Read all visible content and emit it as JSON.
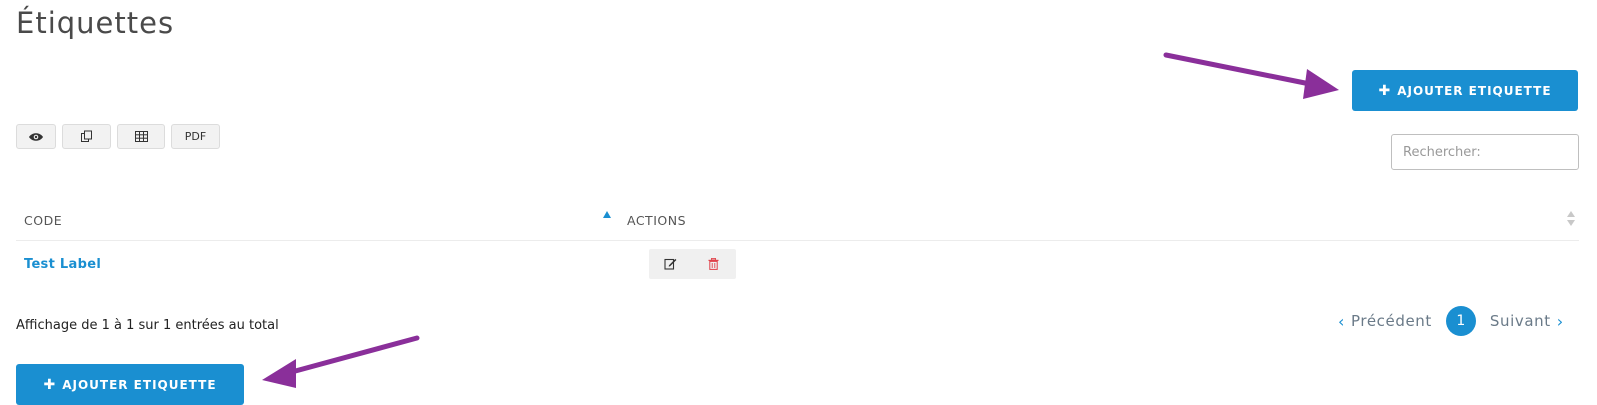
{
  "page": {
    "title": "Étiquettes"
  },
  "toolbar": {
    "add_label": "AJOUTER ETIQUETTE",
    "add_icon": "plus-icon",
    "export_buttons": [
      {
        "name": "view-columns-button",
        "icon": "eye-icon"
      },
      {
        "name": "copy-button",
        "icon": "copy-icon"
      },
      {
        "name": "excel-button",
        "icon": "table-icon"
      },
      {
        "name": "pdf-button",
        "label": "PDF"
      }
    ]
  },
  "search": {
    "placeholder": "Rechercher:",
    "value": ""
  },
  "table": {
    "columns": [
      "CODE",
      "ACTIONS"
    ],
    "rows": [
      {
        "code": "Test Label",
        "actions": [
          "edit-icon",
          "trash-icon"
        ]
      }
    ]
  },
  "pagination": {
    "info": "Affichage de 1 à 1 sur 1 entrées au total",
    "prev": "Précédent",
    "next": "Suivant",
    "current_page": "1"
  },
  "colors": {
    "primary": "#1a8fd1",
    "arrow": "#8a2f9a",
    "danger": "#e0424a"
  }
}
